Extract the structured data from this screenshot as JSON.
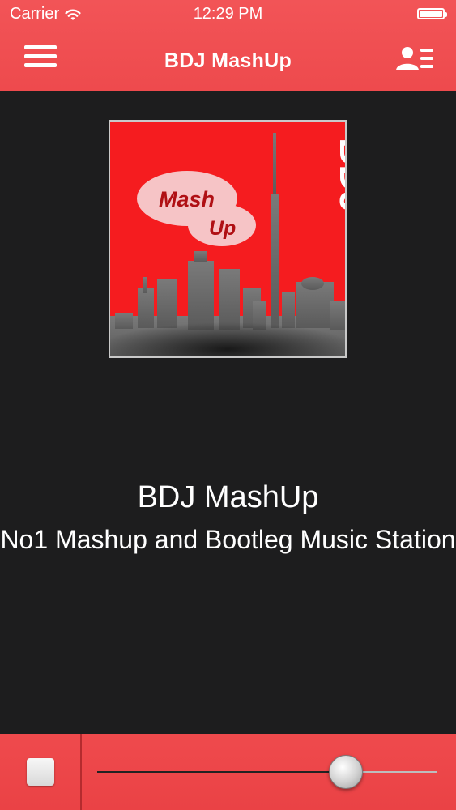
{
  "status_bar": {
    "carrier": "Carrier",
    "time": "12:29 PM",
    "wifi_icon": "wifi-icon",
    "battery_icon": "battery-icon"
  },
  "nav": {
    "title": "BDJ MashUp",
    "menu_icon": "hamburger-menu-icon",
    "profile_icon": "profile-list-icon"
  },
  "artwork": {
    "bubble_line1": "Mash",
    "bubble_line2": "Up",
    "logo_text": "BDJ"
  },
  "station": {
    "name": "BDJ MashUp",
    "description": "No1 Mashup and Bootleg Music Station"
  },
  "player": {
    "stop_icon": "stop-icon",
    "volume_fraction": 0.73
  },
  "colors": {
    "accent": "#ef4a4d",
    "background": "#1d1d1e",
    "artwork_red": "#f51c1f"
  }
}
